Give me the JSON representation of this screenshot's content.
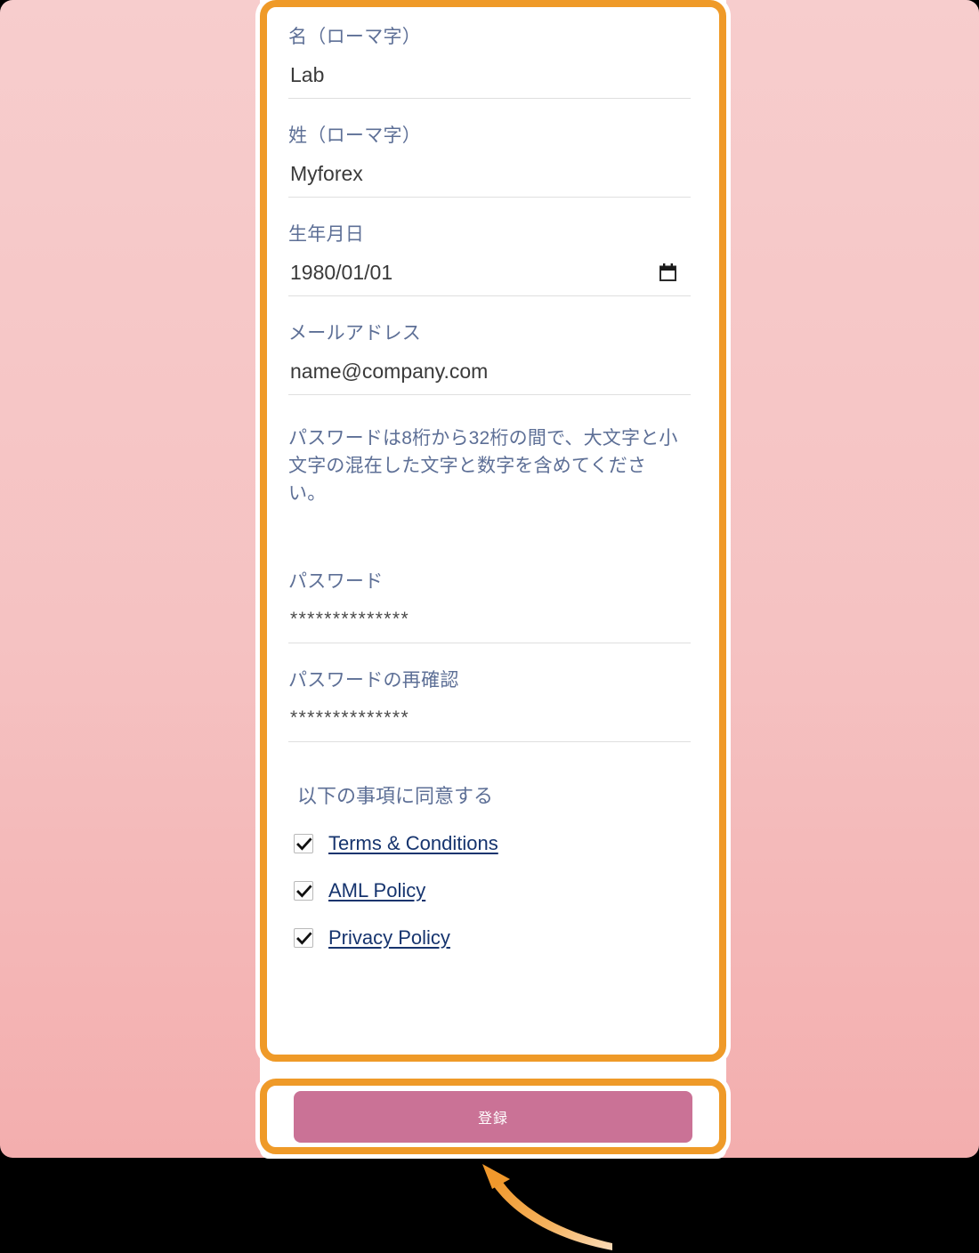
{
  "theme": {
    "page_background": "#f5c2c2",
    "card_background": "#ffffff",
    "highlight_outline": "#ef9a28",
    "label_color": "#5d6f96",
    "link_color": "#16346e",
    "submit_button_color": "#ca7296",
    "underline_color": "#dfdfdf",
    "arrow_color": "#f0a044",
    "outside_background": "#000000"
  },
  "form": {
    "fields": [
      {
        "label": "名（ローマ字）",
        "value": "Lab",
        "type": "text",
        "name": "first-name"
      },
      {
        "label": "姓（ローマ字）",
        "value": "Myforex",
        "type": "text",
        "name": "last-name"
      },
      {
        "label": "生年月日",
        "value": "1980/01/01",
        "type": "date",
        "name": "birth-date",
        "icon": "calendar-icon"
      },
      {
        "label": "メールアドレス",
        "value": "name@company.com",
        "type": "email",
        "name": "email"
      }
    ],
    "password_hint": "パスワードは8桁から32桁の間で、大文字と小文字の混在した文字と数字を含めてください。",
    "password": {
      "label": "パスワード",
      "value": "**************"
    },
    "password_confirm": {
      "label": "パスワードの再確認",
      "value": "**************"
    },
    "agreement": {
      "title": "以下の事項に同意する",
      "items": [
        {
          "label": "Terms & Conditions",
          "checked": true
        },
        {
          "label": "AML Policy",
          "checked": true
        },
        {
          "label": "Privacy Policy",
          "checked": true
        }
      ]
    },
    "submit_label": "登録"
  },
  "annotations": {
    "arrow": "curved-arrow-pointing-to-submit-button"
  }
}
